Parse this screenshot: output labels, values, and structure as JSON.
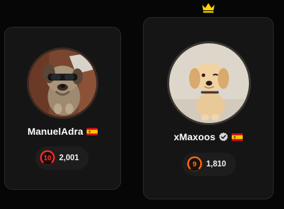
{
  "players": [
    {
      "name": "ManuelAdra",
      "flag": "spain-flag-icon",
      "verified": false,
      "level": "10",
      "elo": "2,001",
      "level_color": "#ff2a1f"
    },
    {
      "name": "xMaxoos",
      "flag": "spain-flag-icon",
      "verified": true,
      "level": "9",
      "elo": "1,810",
      "level_color": "#ff6a13"
    }
  ],
  "leader_icon": "crown-icon",
  "colors": {
    "background": "#060606",
    "card": "#151515",
    "crown": "#ffd400"
  }
}
